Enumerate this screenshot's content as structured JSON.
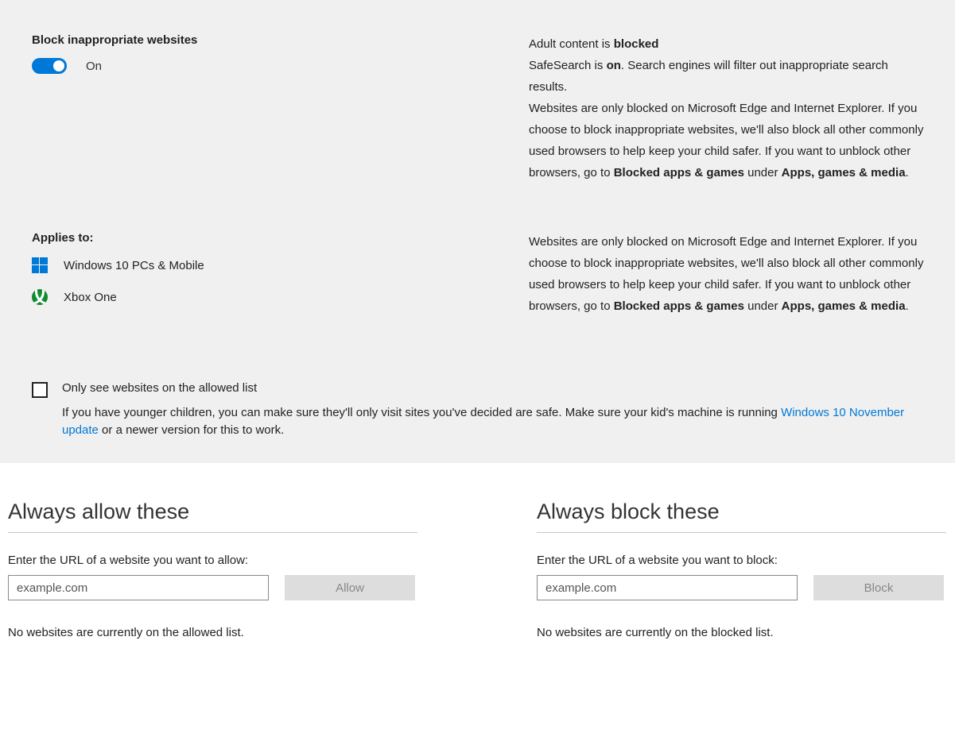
{
  "block": {
    "title": "Block inappropriate websites",
    "toggle_state": "On",
    "desc_parts": {
      "p1a": "Adult content is ",
      "p1b": "blocked",
      "p2a": "SafeSearch is ",
      "p2b": "on",
      "p2c": ". Search engines will filter out inappropriate search results.",
      "p3a": "Websites are only blocked on Microsoft Edge and Internet Explorer. If you choose to block inappropriate websites, we'll also block all other commonly used browsers to help keep your child safer. If you want to unblock other browsers, go to ",
      "p3b": "Blocked apps & games",
      "p3c": " under ",
      "p3d": "Apps, games & media",
      "p3e": "."
    }
  },
  "applies": {
    "heading": "Applies to:",
    "items": [
      {
        "label": "Windows 10 PCs & Mobile"
      },
      {
        "label": "Xbox One"
      }
    ],
    "desc_parts": {
      "a": "Websites are only blocked on Microsoft Edge and Internet Explorer. If you choose to block inappropriate websites, we'll also block all other commonly used browsers to help keep your child safer. If you want to unblock other browsers, go to ",
      "b": "Blocked apps & games",
      "c": " under ",
      "d": "Apps, games & media",
      "e": "."
    }
  },
  "allowed_only": {
    "label": "Only see websites on the allowed list",
    "help_a": "If you have younger children, you can make sure they'll only visit sites you've decided are safe. Make sure your kid's machine is running ",
    "help_link": "Windows 10 November update",
    "help_b": " or a newer version for this to work."
  },
  "allow": {
    "heading": "Always allow these",
    "field_label": "Enter the URL of a website you want to allow:",
    "placeholder": "example.com",
    "button": "Allow",
    "empty": "No websites are currently on the allowed list."
  },
  "blocklist": {
    "heading": "Always block these",
    "field_label": "Enter the URL of a website you want to block:",
    "placeholder": "example.com",
    "button": "Block",
    "empty": "No websites are currently on the blocked list."
  }
}
